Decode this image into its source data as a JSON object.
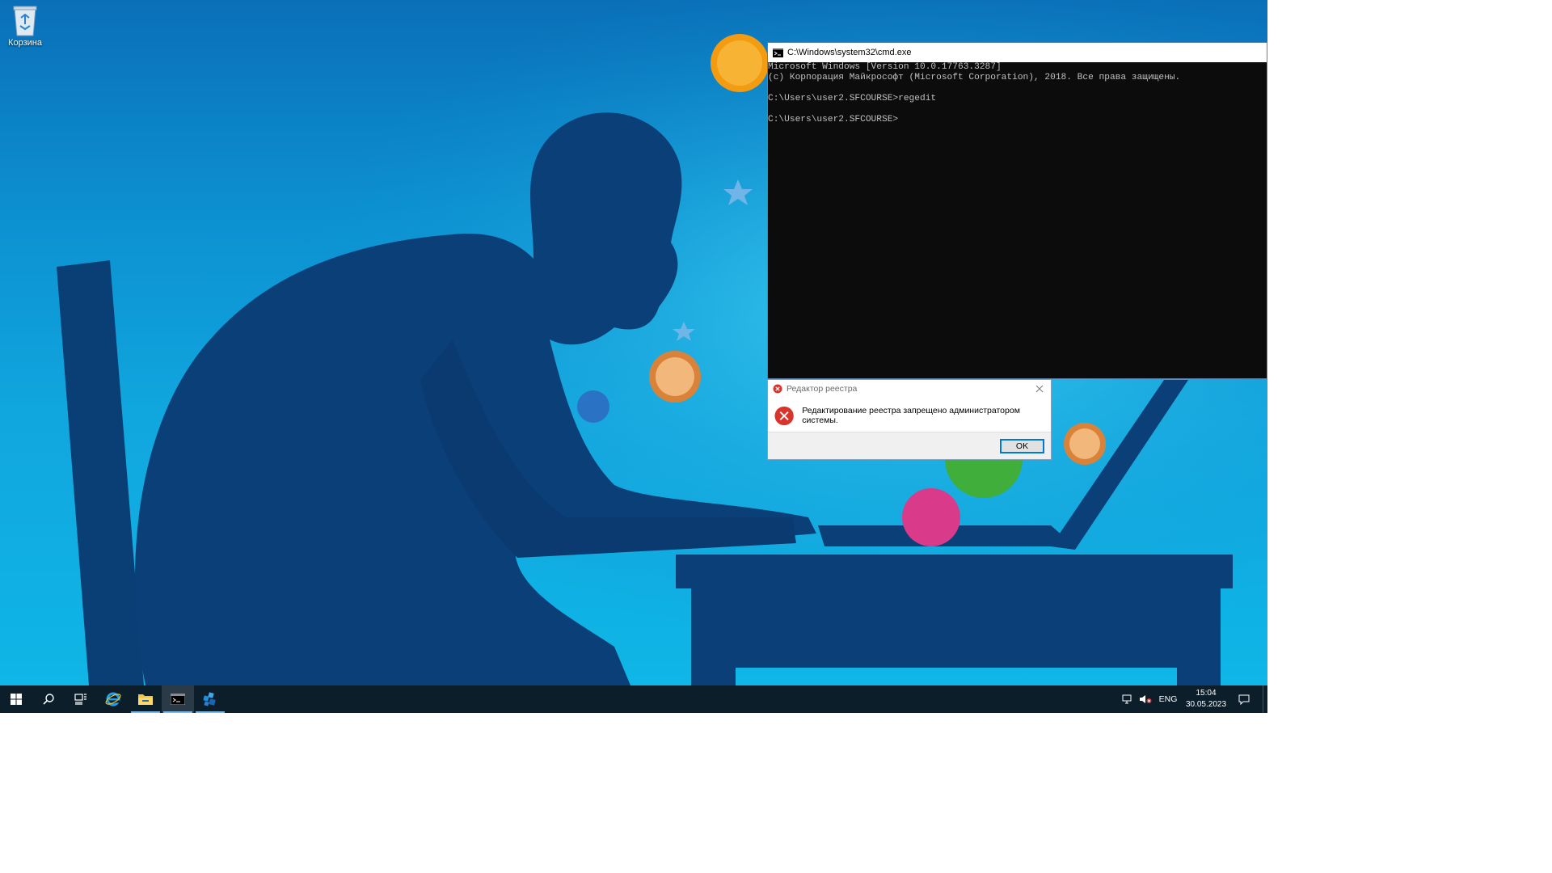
{
  "desktop": {
    "icons": [
      {
        "label": "Корзина",
        "icon": "recycle-bin-icon"
      }
    ]
  },
  "cmd_window": {
    "title": "C:\\Windows\\system32\\cmd.exe",
    "icon": "console-icon",
    "background": "#0c0c0c",
    "text_color": "#c0c0c0",
    "lines": [
      "Microsoft Windows [Version 10.0.17763.3287]",
      "(c) Корпорация Майкрософт (Microsoft Corporation), 2018. Все права защищены.",
      "",
      "C:\\Users\\user2.SFCOURSE>regedit",
      "",
      "C:\\Users\\user2.SFCOURSE>"
    ]
  },
  "error_dialog": {
    "title": "Редактор реестра",
    "message": "Редактирование реестра запрещено администратором системы.",
    "ok_label": "OK",
    "icon": "error-icon",
    "accent": "#d9342b"
  },
  "taskbar": {
    "background": "#0d1e2b",
    "items": [
      {
        "name": "start-button",
        "icon": "windows-logo-icon"
      },
      {
        "name": "search-button",
        "icon": "search-icon"
      },
      {
        "name": "task-view-button",
        "icon": "task-view-icon"
      },
      {
        "name": "internet-explorer-button",
        "icon": "internet-explorer-icon"
      },
      {
        "name": "file-explorer-button",
        "icon": "folder-icon"
      },
      {
        "name": "cmd-taskbar-button",
        "icon": "console-icon"
      },
      {
        "name": "regedit-taskbar-button",
        "icon": "registry-editor-icon"
      }
    ],
    "tray": {
      "language": "ENG",
      "time": "15:04",
      "date": "30.05.2023"
    }
  }
}
